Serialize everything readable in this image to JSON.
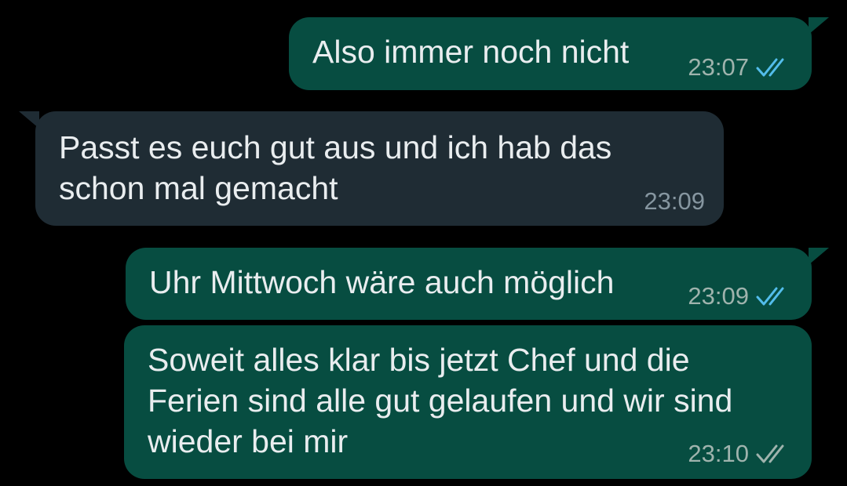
{
  "colors": {
    "background": "#000000",
    "outgoing_bubble": "#074d41",
    "incoming_bubble": "#1f2c34",
    "message_text": "#e9edef",
    "read_ticks": "#53bdeb",
    "delivered_ticks": "#9fb3ad"
  },
  "messages": [
    {
      "direction": "outgoing",
      "text": "Also immer noch nicht",
      "time": "23:07",
      "status_icon": "double-check-read-icon"
    },
    {
      "direction": "incoming",
      "text": "Passt es euch gut aus und ich hab das\nschon mal gemacht",
      "time": "23:09"
    },
    {
      "direction": "outgoing",
      "text": "Uhr Mittwoch wäre auch möglich",
      "time": "23:09",
      "status_icon": "double-check-read-icon"
    },
    {
      "direction": "outgoing",
      "text": "Soweit alles klar bis jetzt Chef und die\nFerien sind alle gut gelaufen und wir sind\nwieder bei mir",
      "time": "23:10",
      "status_icon": "double-check-delivered-icon"
    }
  ]
}
